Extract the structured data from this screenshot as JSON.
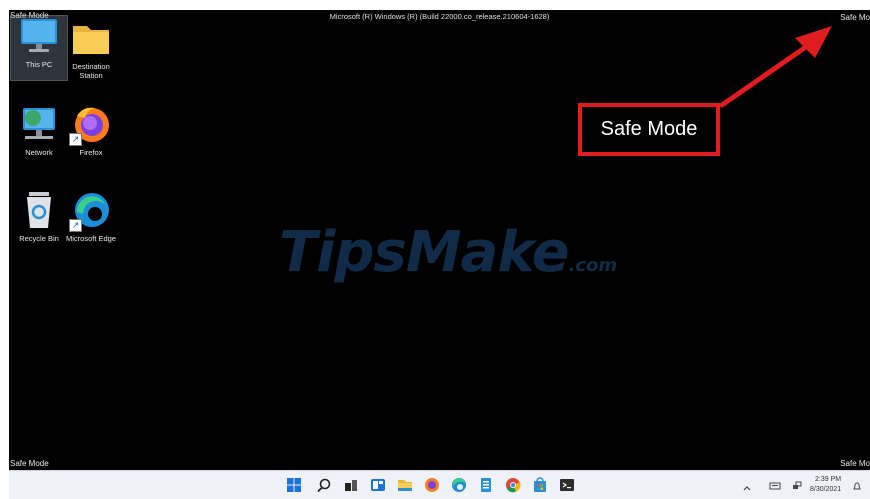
{
  "screen": {
    "build_text": "Microsoft (R) Windows (R) (Build 22000.co_release.210604-1628)",
    "safe_mode_top_left": "Safe Mode",
    "safe_mode_top_right": "Safe Mo",
    "safe_mode_bottom_left": "Safe Mode",
    "safe_mode_bottom_right": "Safe Mo"
  },
  "desktop_icons": [
    {
      "label": "This PC",
      "icon": "this-pc-icon",
      "selected": true
    },
    {
      "label": "Destination Station",
      "icon": "folder-icon"
    },
    {
      "label": "Network",
      "icon": "network-icon"
    },
    {
      "label": "Firefox",
      "icon": "firefox-icon",
      "shortcut": true
    },
    {
      "label": "Recycle Bin",
      "icon": "recycle-bin-icon"
    },
    {
      "label": "Microsoft Edge",
      "icon": "edge-icon",
      "shortcut": true
    }
  ],
  "callout": {
    "text": "Safe Mode",
    "color": "#e11c1c"
  },
  "watermark": {
    "text": "TipsMake",
    "suffix": ".com"
  },
  "taskbar": {
    "icons": [
      "windows-start-icon",
      "search-icon",
      "task-view-icon",
      "widgets-icon",
      "file-explorer-icon",
      "firefox-icon",
      "edge-icon",
      "notepad-icon",
      "chrome-icon",
      "store-icon",
      "terminal-icon"
    ],
    "tray": {
      "time": "2:39 PM",
      "date": "8/30/2021"
    }
  },
  "colors": {
    "desktop_bg": "#000000",
    "taskbar_bg": "#eef1f6",
    "accent_red": "#e11c1c"
  }
}
